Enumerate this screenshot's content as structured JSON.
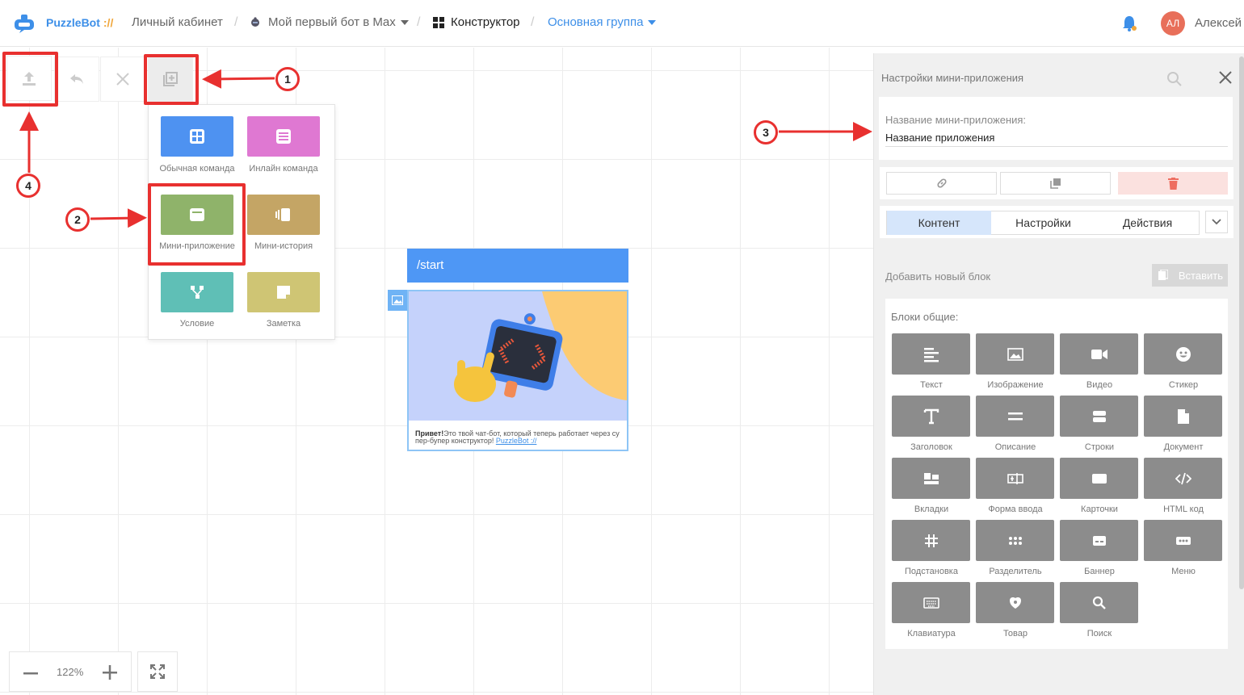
{
  "header": {
    "brand": "PuzzleBot",
    "brand_slashes": "://",
    "breadcrumbs": [
      {
        "label": "Личный кабинет"
      },
      {
        "label": "Мой первый бот в Max"
      },
      {
        "label": "Конструктор"
      },
      {
        "label": "Основная группа"
      }
    ],
    "separator": "/",
    "avatar_initials": "АЛ",
    "username": "Алексей"
  },
  "canvas": {
    "popup_items": [
      {
        "label": "Обычная команда",
        "color": "#4e92f1"
      },
      {
        "label": "Инлайн команда",
        "color": "#df78d2"
      },
      {
        "label": "Мини-приложение",
        "color": "#8fb36a"
      },
      {
        "label": "Мини-история",
        "color": "#c4a565"
      },
      {
        "label": "Условие",
        "color": "#5fbfb6"
      },
      {
        "label": "Заметка",
        "color": "#cfc574"
      }
    ],
    "markers": [
      "1",
      "2",
      "3",
      "4"
    ],
    "node": {
      "title": "/start",
      "text_bold": "Привет!",
      "text": "Это твой чат-бот, который теперь работает через су пер-бупер конструктор! ",
      "link": "PuzzleBot ://"
    },
    "zoom": "122%"
  },
  "panel": {
    "title": "Настройки мини-приложения",
    "name_label": "Название мини-приложения:",
    "name_value": "Название приложения",
    "tabs": [
      "Контент",
      "Настройки",
      "Действия"
    ],
    "add_block_label": "Добавить новый блок",
    "paste_label": "Вставить",
    "blocks_title": "Блоки общие:",
    "blocks": [
      "Текст",
      "Изображение",
      "Видео",
      "Стикер",
      "Заголовок",
      "Описание",
      "Строки",
      "Документ",
      "Вкладки",
      "Форма ввода",
      "Карточки",
      "HTML код",
      "Подстановка",
      "Разделитель",
      "Баннер",
      "Меню",
      "Клавиатура",
      "Товар",
      "Поиск"
    ]
  },
  "colors": {
    "accent": "#3d8fe8",
    "highlight": "#e8302f",
    "block": "#8c8c8c"
  }
}
